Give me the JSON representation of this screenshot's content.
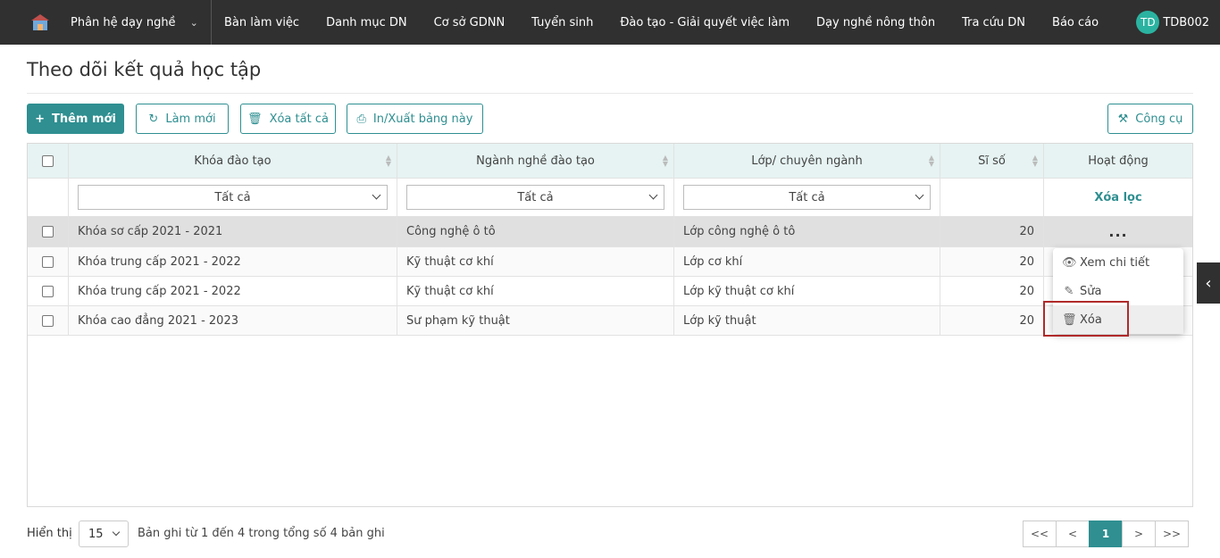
{
  "topbar": {
    "module": "Phân hệ dạy nghề",
    "nav": [
      "Bàn làm việc",
      "Danh mục DN",
      "Cơ sở GDNN",
      "Tuyển sinh",
      "Đào tạo - Giải quyết việc làm",
      "Dạy nghề nông thôn",
      "Tra cứu DN",
      "Báo cáo"
    ],
    "user_initials": "TD",
    "user_name": "TDB002"
  },
  "page_title": "Theo dõi kết quả học tập",
  "toolbar": {
    "add": "Thêm mới",
    "refresh": "Làm mới",
    "delete_all": "Xóa tất cả",
    "print": "In/Xuất bảng này",
    "tools": "Công cụ"
  },
  "table": {
    "headers": [
      "Khóa đào tạo",
      "Ngành nghề đào tạo",
      "Lớp/ chuyên ngành",
      "Sĩ số",
      "Hoạt động"
    ],
    "filters": [
      "Tất cả",
      "Tất cả",
      "Tất cả"
    ],
    "clear_filter": "Xóa lọc",
    "rows": [
      {
        "course": "Khóa sơ cấp 2021 - 2021",
        "major": "Công nghệ ô tô",
        "class": "Lớp công nghệ ô tô",
        "count": "20"
      },
      {
        "course": "Khóa trung cấp 2021 - 2022",
        "major": "Kỹ thuật cơ khí",
        "class": "Lớp cơ khí",
        "count": "20"
      },
      {
        "course": "Khóa trung cấp 2021 - 2022",
        "major": "Kỹ thuật cơ khí",
        "class": "Lớp kỹ thuật cơ khí",
        "count": "20"
      },
      {
        "course": "Khóa cao đẳng 2021 - 2023",
        "major": "Sư phạm kỹ thuật",
        "class": "Lớp kỹ thuật",
        "count": "20"
      }
    ],
    "action_dots": "..."
  },
  "context_menu": {
    "view": "Xem chi tiết",
    "edit": "Sửa",
    "delete": "Xóa"
  },
  "footer": {
    "show_label": "Hiển thị",
    "page_size": "15",
    "records": "Bản ghi từ 1 đến 4 trong tổng số 4 bản ghi",
    "pager": [
      "<<",
      "<",
      "1",
      ">",
      ">>"
    ]
  },
  "colors": {
    "accent": "#2f8f91",
    "topbar": "#303030",
    "avatar": "#2bb3a1"
  }
}
